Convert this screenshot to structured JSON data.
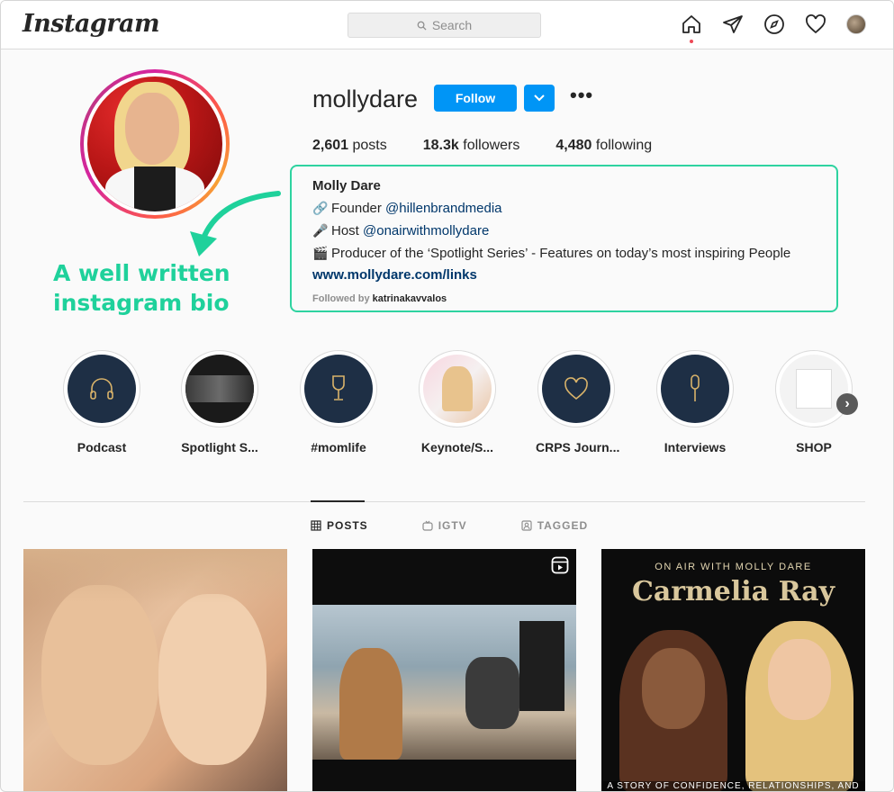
{
  "app": {
    "logo": "Instagram"
  },
  "search": {
    "placeholder": "Search"
  },
  "profile": {
    "username": "mollydare",
    "follow_label": "Follow",
    "more_label": "•••",
    "stats": [
      {
        "value": "2,601",
        "label": "posts"
      },
      {
        "value": "18.3k",
        "label": "followers"
      },
      {
        "value": "4,480",
        "label": "following"
      }
    ],
    "bio": {
      "name": "Molly Dare",
      "line1_prefix": "Founder",
      "line1_mention": "@hillenbrandmedia",
      "line2_prefix": "Host",
      "line2_mention": "@onairwithmollydare",
      "line3": "Producer of the ‘Spotlight Series’ - Features on today’s most inspiring People",
      "link": "www.mollydare.com/links",
      "followed_by_label": "Followed by",
      "followed_by_user": "katrinakavvalos"
    }
  },
  "annotation": {
    "line1": "A well written",
    "line2": "instagram bio",
    "color": "#1fd19b"
  },
  "highlights": [
    {
      "label": "Podcast",
      "icon": "headphones-icon"
    },
    {
      "label": "Spotlight S...",
      "icon": "video-thumbnail"
    },
    {
      "label": "#momlife",
      "icon": "wine-glass-icon"
    },
    {
      "label": "Keynote/S...",
      "icon": "poster-thumbnail"
    },
    {
      "label": "CRPS Journ...",
      "icon": "heart-icon"
    },
    {
      "label": "Interviews",
      "icon": "microphone-icon"
    },
    {
      "label": "SHOP",
      "icon": "shop-thumbnail"
    }
  ],
  "tabs": [
    {
      "label": "POSTS",
      "icon": "grid-icon",
      "active": true
    },
    {
      "label": "IGTV",
      "icon": "tv-icon",
      "active": false
    },
    {
      "label": "TAGGED",
      "icon": "tag-icon",
      "active": false
    }
  ],
  "posts": {
    "post3_subtitle": "ON AIR WITH MOLLY DARE",
    "post3_title": "Carmelia Ray",
    "post3_bottom": "A STORY OF CONFIDENCE, RELATIONSHIPS, AND"
  },
  "colors": {
    "accent": "#0095f6",
    "highlight_fill": "#1e2f45",
    "annotation": "#1fd19b"
  }
}
